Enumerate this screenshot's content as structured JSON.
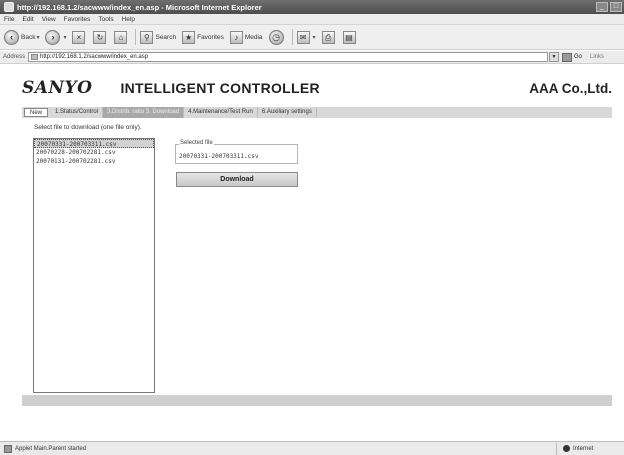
{
  "window": {
    "title": "http://192.168.1.2/sacwww/index_en.asp - Microsoft Internet Explorer"
  },
  "menubar": {
    "items": [
      "File",
      "Edit",
      "View",
      "Favorites",
      "Tools",
      "Help"
    ]
  },
  "toolbar": {
    "back_label": "Back",
    "search_label": "Search",
    "favorites_label": "Favorites",
    "media_label": "Media"
  },
  "addressbar": {
    "label": "Address",
    "url": "http://192.168.1.2/sacwww/index_en.asp",
    "go_label": "Go",
    "links_label": "Links"
  },
  "header": {
    "brand": "SANYO",
    "app_title": "INTELLIGENT CONTROLLER",
    "company": "AAA Co.,Ltd."
  },
  "nav": {
    "new_label": "New",
    "tabs": [
      "1.Status/Control",
      "3.Distrib. ratio 3. Download",
      "4.Maintenance/Test Run",
      "6.Auxiliary settings"
    ],
    "active_index": 1
  },
  "download": {
    "instruction": "Select file to download (one file only).",
    "files": [
      "20070331-200703311.csv",
      "20070228-200702281.csv",
      "20070131-200702281.csv"
    ],
    "selected_index": 0,
    "selected_legend": "Selected file",
    "selected_value": "20070331-200703311.csv",
    "button_label": "Download"
  },
  "statusbar": {
    "message": "Applet Main.Parent started",
    "zone": "Internet"
  }
}
